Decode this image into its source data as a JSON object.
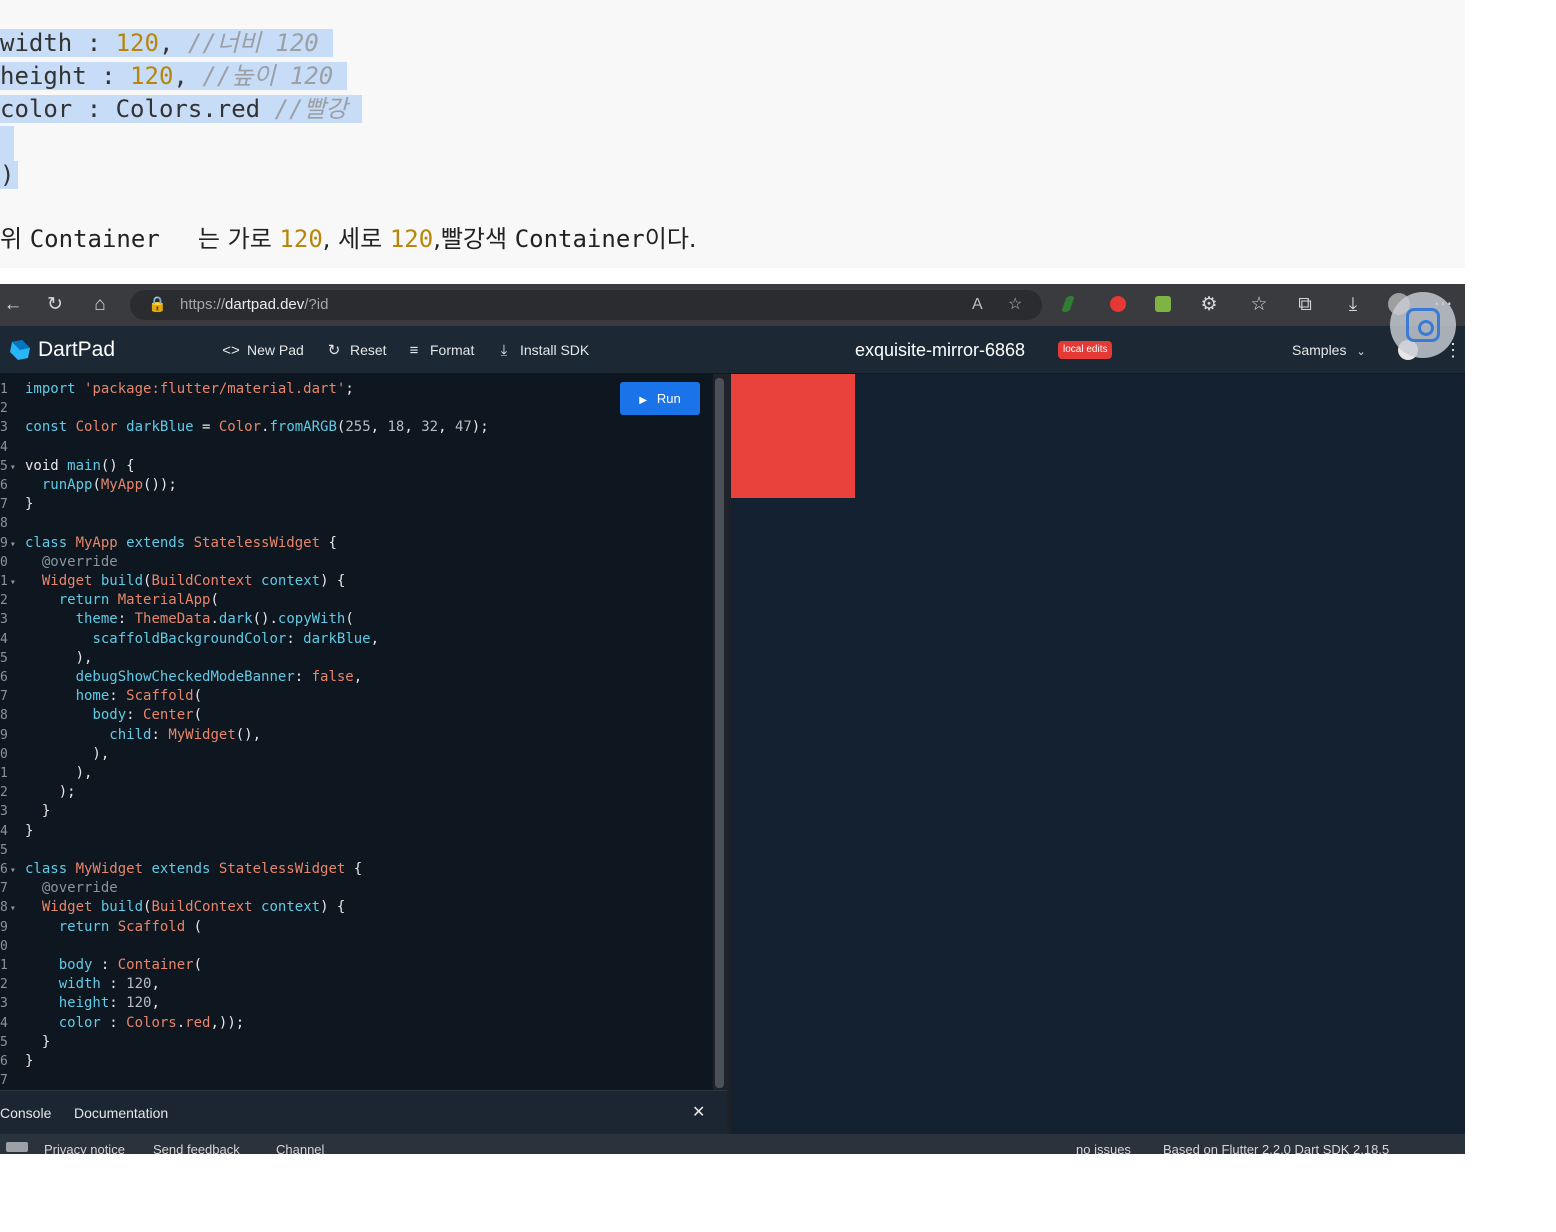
{
  "blog": {
    "code_lines": [
      {
        "prop": "width",
        "sep": " : ",
        "value": "120",
        "tail": ", ",
        "comment": "//너비 120"
      },
      {
        "prop": "height",
        "sep": " : ",
        "value": "120",
        "tail": ", ",
        "comment": "//높이 120"
      },
      {
        "prop": "color",
        "sep": " : ",
        "value": "Colors.red",
        "tail": " ",
        "comment": "//빨강"
      }
    ],
    "closing": ")",
    "paragraph": {
      "p1": "위 ",
      "p2": "Container",
      "p3": "     는 가로 ",
      "n1": "120",
      "p4": ", 세로 ",
      "n2": "120",
      "p5": ",빨강색 ",
      "p6": "Container",
      "p7": "이다."
    }
  },
  "browser": {
    "url_prefix": "https://",
    "url_host": "dartpad.dev",
    "url_path": "/?id",
    "icons": [
      "back-icon",
      "reload-icon",
      "home-icon",
      "lock-icon",
      "read-aloud-icon",
      "favorite-add-icon",
      "extensions-icon",
      "favorites-icon",
      "collections-icon",
      "downloads-icon",
      "profile-icon",
      "more-icon"
    ],
    "glyphs": {
      "back": "←",
      "reload": "↻",
      "home": "⌂",
      "lock": "🔒",
      "read": "A",
      "fav": "☆",
      "ext": "⚙",
      "favs": "☆",
      "coll": "⧉",
      "down": "⤓",
      "more": "⋯"
    }
  },
  "dartpad": {
    "app_name": "DartPad",
    "buttons": {
      "new_pad": "New Pad",
      "reset": "Reset",
      "format": "Format",
      "install_sdk": "Install SDK"
    },
    "button_glyphs": {
      "new_pad": "<>",
      "reset": "↻",
      "format": "≡",
      "install_sdk": "⤓"
    },
    "pad_name": "exquisite-mirror-6868",
    "badge": "local edits",
    "samples": "Samples",
    "samples_chev": "⌄",
    "kebab": "⋮",
    "run": "Run",
    "run_glyph": "▶",
    "console_tabs": [
      "Console",
      "Documentation"
    ],
    "close_glyph": "✕",
    "footer": [
      "Privacy notice",
      "Send feedback",
      "Channel",
      "no issues",
      "Based on Flutter 2.2.0 Dart SDK 2.18.5"
    ]
  },
  "editor": {
    "lines": [
      {
        "n": "1",
        "f": "",
        "c": [
          [
            "kw",
            "import "
          ],
          [
            "st",
            "'package:flutter/material.dart'"
          ],
          [
            "",
            ";"
          ]
        ]
      },
      {
        "n": "2",
        "f": "",
        "c": []
      },
      {
        "n": "3",
        "f": "",
        "c": [
          [
            "kw",
            "const "
          ],
          [
            "ty",
            "Color "
          ],
          [
            "kw",
            "darkBlue "
          ],
          [
            "",
            "= "
          ],
          [
            "ty",
            "Color"
          ],
          [
            "",
            "."
          ],
          [
            "kw",
            "fromARGB"
          ],
          [
            "",
            "("
          ],
          [
            "nu",
            "255"
          ],
          [
            "",
            ", "
          ],
          [
            "nu",
            "18"
          ],
          [
            "",
            ", "
          ],
          [
            "nu",
            "32"
          ],
          [
            "",
            ", "
          ],
          [
            "nu",
            "47"
          ],
          [
            "",
            ");"
          ]
        ]
      },
      {
        "n": "4",
        "f": "",
        "c": []
      },
      {
        "n": "5",
        "f": "▾",
        "c": [
          [
            "",
            "void "
          ],
          [
            "kw",
            "main"
          ],
          [
            "",
            "() {"
          ]
        ]
      },
      {
        "n": "6",
        "f": "",
        "c": [
          [
            "",
            "  "
          ],
          [
            "kw",
            "runApp"
          ],
          [
            "",
            "("
          ],
          [
            "ty",
            "MyApp"
          ],
          [
            "",
            "());"
          ]
        ]
      },
      {
        "n": "7",
        "f": "",
        "c": [
          [
            "",
            "}"
          ]
        ]
      },
      {
        "n": "8",
        "f": "",
        "c": []
      },
      {
        "n": "9",
        "f": "▾",
        "c": [
          [
            "kw",
            "class "
          ],
          [
            "ty",
            "MyApp "
          ],
          [
            "kw",
            "extends "
          ],
          [
            "ty",
            "StatelessWidget "
          ],
          [
            "",
            "{"
          ]
        ]
      },
      {
        "n": "0",
        "f": "",
        "c": [
          [
            "",
            "  "
          ],
          [
            "an",
            "@override"
          ]
        ]
      },
      {
        "n": "1",
        "f": "▾",
        "c": [
          [
            "",
            "  "
          ],
          [
            "ty",
            "Widget "
          ],
          [
            "kw",
            "build"
          ],
          [
            "",
            "("
          ],
          [
            "ty",
            "BuildContext "
          ],
          [
            "kw",
            "context"
          ],
          [
            "",
            ") {"
          ]
        ]
      },
      {
        "n": "2",
        "f": "",
        "c": [
          [
            "",
            "    "
          ],
          [
            "kw",
            "return "
          ],
          [
            "ty",
            "MaterialApp"
          ],
          [
            "",
            "("
          ]
        ]
      },
      {
        "n": "3",
        "f": "",
        "c": [
          [
            "",
            "      "
          ],
          [
            "pr",
            "theme"
          ],
          [
            "",
            ": "
          ],
          [
            "ty",
            "ThemeData"
          ],
          [
            "",
            "."
          ],
          [
            "kw",
            "dark"
          ],
          [
            "",
            "()."
          ],
          [
            "kw",
            "copyWith"
          ],
          [
            "",
            "("
          ]
        ]
      },
      {
        "n": "4",
        "f": "",
        "c": [
          [
            "",
            "        "
          ],
          [
            "pr",
            "scaffoldBackgroundColor"
          ],
          [
            "",
            ": "
          ],
          [
            "kw",
            "darkBlue"
          ],
          [
            "",
            ","
          ]
        ]
      },
      {
        "n": "5",
        "f": "",
        "c": [
          [
            "",
            "      ),"
          ]
        ]
      },
      {
        "n": "6",
        "f": "",
        "c": [
          [
            "",
            "      "
          ],
          [
            "pr",
            "debugShowCheckedModeBanner"
          ],
          [
            "",
            ": "
          ],
          [
            "ty",
            "false"
          ],
          [
            "",
            ","
          ]
        ]
      },
      {
        "n": "7",
        "f": "",
        "c": [
          [
            "",
            "      "
          ],
          [
            "pr",
            "home"
          ],
          [
            "",
            ": "
          ],
          [
            "ty",
            "Scaffold"
          ],
          [
            "",
            "("
          ]
        ]
      },
      {
        "n": "8",
        "f": "",
        "c": [
          [
            "",
            "        "
          ],
          [
            "pr",
            "body"
          ],
          [
            "",
            ": "
          ],
          [
            "ty",
            "Center"
          ],
          [
            "",
            "("
          ]
        ]
      },
      {
        "n": "9",
        "f": "",
        "c": [
          [
            "",
            "          "
          ],
          [
            "pr",
            "child"
          ],
          [
            "",
            ": "
          ],
          [
            "ty",
            "MyWidget"
          ],
          [
            "",
            "(),"
          ]
        ]
      },
      {
        "n": "0",
        "f": "",
        "c": [
          [
            "",
            "        ),"
          ]
        ]
      },
      {
        "n": "1",
        "f": "",
        "c": [
          [
            "",
            "      ),"
          ]
        ]
      },
      {
        "n": "2",
        "f": "",
        "c": [
          [
            "",
            "    );"
          ]
        ]
      },
      {
        "n": "3",
        "f": "",
        "c": [
          [
            "",
            "  }"
          ]
        ]
      },
      {
        "n": "4",
        "f": "",
        "c": [
          [
            "",
            "}"
          ]
        ]
      },
      {
        "n": "5",
        "f": "",
        "c": []
      },
      {
        "n": "6",
        "f": "▾",
        "c": [
          [
            "kw",
            "class "
          ],
          [
            "ty",
            "MyWidget "
          ],
          [
            "kw",
            "extends "
          ],
          [
            "ty",
            "StatelessWidget "
          ],
          [
            "",
            "{"
          ]
        ]
      },
      {
        "n": "7",
        "f": "",
        "c": [
          [
            "",
            "  "
          ],
          [
            "an",
            "@override"
          ]
        ]
      },
      {
        "n": "8",
        "f": "▾",
        "c": [
          [
            "",
            "  "
          ],
          [
            "ty",
            "Widget "
          ],
          [
            "kw",
            "build"
          ],
          [
            "",
            "("
          ],
          [
            "ty",
            "BuildContext "
          ],
          [
            "kw",
            "context"
          ],
          [
            "",
            ") {"
          ]
        ]
      },
      {
        "n": "9",
        "f": "",
        "c": [
          [
            "",
            "    "
          ],
          [
            "kw",
            "return "
          ],
          [
            "ty",
            "Scaffold "
          ],
          [
            "",
            "("
          ]
        ]
      },
      {
        "n": "0",
        "f": "",
        "c": []
      },
      {
        "n": "1",
        "f": "",
        "c": [
          [
            "",
            "    "
          ],
          [
            "pr",
            "body "
          ],
          [
            "",
            ": "
          ],
          [
            "ty",
            "Container"
          ],
          [
            "",
            "("
          ]
        ]
      },
      {
        "n": "2",
        "f": "",
        "c": [
          [
            "",
            "    "
          ],
          [
            "pr",
            "width "
          ],
          [
            "",
            ": "
          ],
          [
            "nu",
            "120"
          ],
          [
            "",
            ","
          ]
        ]
      },
      {
        "n": "3",
        "f": "",
        "c": [
          [
            "",
            "    "
          ],
          [
            "pr",
            "height"
          ],
          [
            "",
            ": "
          ],
          [
            "nu",
            "120"
          ],
          [
            "",
            ","
          ]
        ]
      },
      {
        "n": "4",
        "f": "",
        "c": [
          [
            "",
            "    "
          ],
          [
            "pr",
            "color "
          ],
          [
            "",
            ": "
          ],
          [
            "ty",
            "Colors"
          ],
          [
            "",
            "."
          ],
          [
            "ty",
            "red"
          ],
          [
            "",
            ",));"
          ]
        ]
      },
      {
        "n": "5",
        "f": "",
        "c": [
          [
            "",
            "  }"
          ]
        ]
      },
      {
        "n": "6",
        "f": "",
        "c": [
          [
            "",
            "}"
          ]
        ]
      },
      {
        "n": "7",
        "f": "",
        "c": []
      }
    ]
  },
  "colors": {
    "output_box": "#e9423d",
    "run_button": "#1a73e8",
    "badge": "#e53935"
  }
}
